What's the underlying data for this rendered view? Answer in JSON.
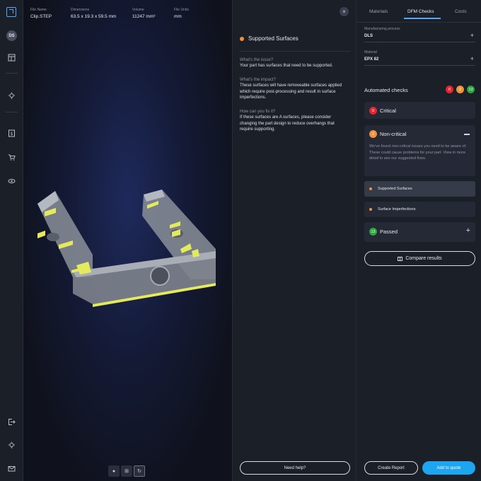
{
  "rail": {
    "avatar": "DS",
    "icons_top": [
      "logo-icon",
      "avatar",
      "layout-icon",
      "lightbulb-icon",
      "dollar-icon",
      "cart-icon",
      "eye-cloud-icon"
    ],
    "icons_bottom": [
      "logout-icon",
      "lightbulb-icon",
      "mail-icon"
    ]
  },
  "file": {
    "name_label": "File Name",
    "name": "Clip.STEP",
    "dims_label": "Dimensions",
    "dims": "63.5 x 19.3 x 59.5 mm",
    "volume_label": "Volume",
    "volume": "11247 mm³",
    "units_label": "File Units",
    "units": "mm"
  },
  "issue": {
    "close": "×",
    "title": "Supported Surfaces",
    "q1": "What's the issue?",
    "a1": "Your part has surfaces that need to be supported.",
    "q2": "What's the impact?",
    "a2": "These surfaces will have removeable surfaces applied which require post-processing and result in surface imperfections.",
    "q3": "How can you fix it?",
    "a3": "If these surfaces are A surfaces, please consider changing the part design to reduce overhangs that require supporting.",
    "help_button": "Need help?"
  },
  "tabs": [
    "Materials",
    "DFM Checks",
    "Costs"
  ],
  "active_tab": "DFM Checks",
  "process": {
    "label": "Manufacturing process",
    "value": "DLS"
  },
  "material": {
    "label": "Material",
    "value": "EPX 82"
  },
  "checks": {
    "title": "Automated checks",
    "critical_count": "0",
    "noncritical_count": "2",
    "passed_count": "13",
    "critical_label": "Critical",
    "noncritical_label": "Non-critical",
    "noncritical_desc": "We've found non-critical issues you need to be aware of. These could cause problems for your part. View in more detail to see our suggested fixes.",
    "items": [
      "Supported Surfaces",
      "Surface Imperfections"
    ],
    "passed_label": "Passed"
  },
  "colors": {
    "critical": "#e5252f",
    "noncritical": "#f0923a",
    "passed": "#2aa63c",
    "accent": "#1ea5f0"
  },
  "compare_button": "Compare results",
  "create_report_button": "Create Report",
  "add_quote_button": "Add to quote"
}
